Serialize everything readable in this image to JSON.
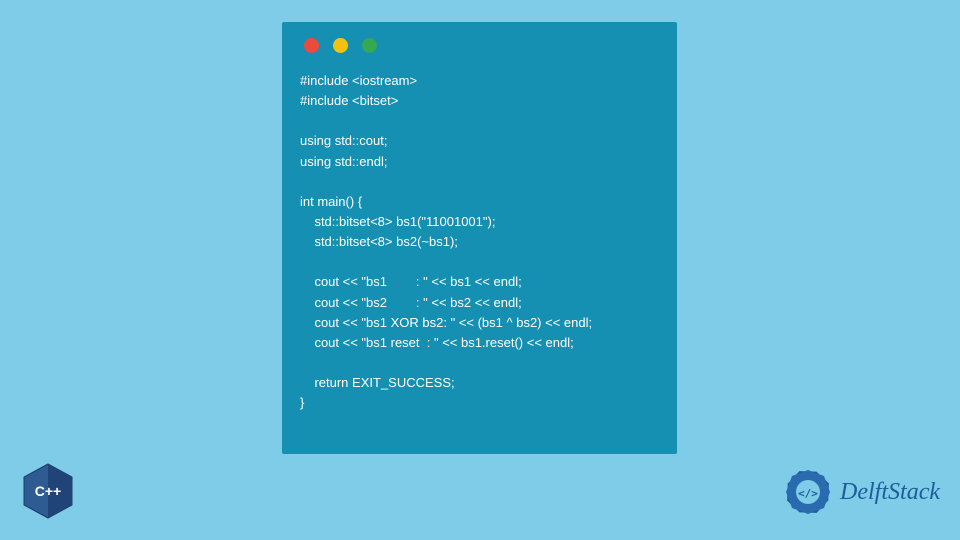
{
  "code_window": {
    "traffic_lights": [
      "red",
      "yellow",
      "green"
    ],
    "code": "#include <iostream>\n#include <bitset>\n\nusing std::cout;\nusing std::endl;\n\nint main() {\n    std::bitset<8> bs1(\"11001001\");\n    std::bitset<8> bs2(~bs1);\n\n    cout << \"bs1        : \" << bs1 << endl;\n    cout << \"bs2        : \" << bs2 << endl;\n    cout << \"bs1 XOR bs2: \" << (bs1 ^ bs2) << endl;\n    cout << \"bs1 reset  : \" << bs1.reset() << endl;\n\n    return EXIT_SUCCESS;\n}"
  },
  "cpp_badge": {
    "label": "C++"
  },
  "delft_logo": {
    "text": "DelftStack"
  }
}
